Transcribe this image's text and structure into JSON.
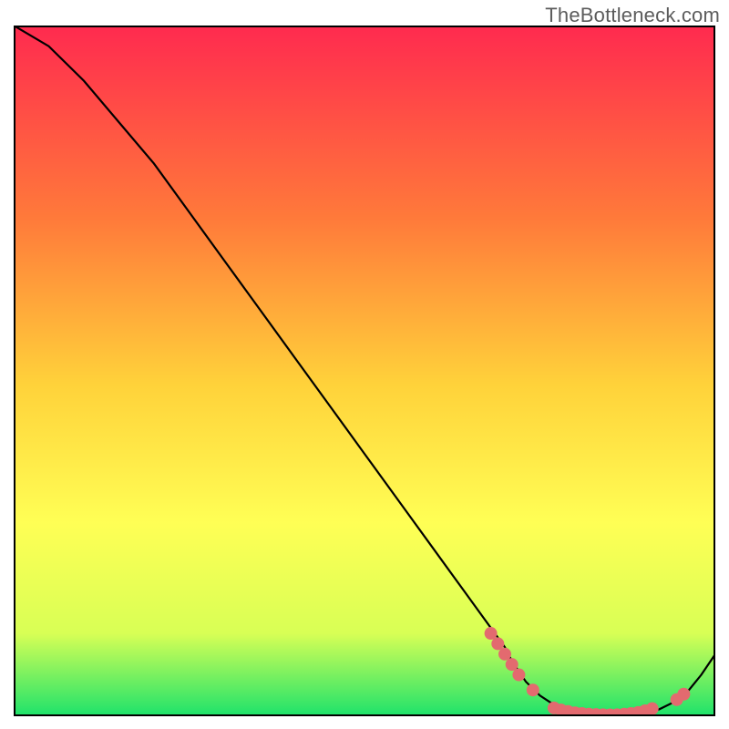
{
  "watermark": "TheBottleneck.com",
  "colors": {
    "gradient_top": "#ff2a4f",
    "gradient_mid1": "#ff7a3a",
    "gradient_mid2": "#ffd23a",
    "gradient_mid3": "#ffff55",
    "gradient_mid4": "#d8ff55",
    "gradient_bottom": "#1de26b",
    "curve": "#000000",
    "marker_fill": "#e36a6f",
    "marker_stroke": "#d0555a",
    "border": "#000000"
  },
  "chart_data": {
    "type": "line",
    "title": "",
    "xlabel": "",
    "ylabel": "",
    "xlim": [
      0,
      100
    ],
    "ylim": [
      0,
      100
    ],
    "series": [
      {
        "name": "bottleneck-curve",
        "x": [
          0,
          5,
          10,
          15,
          20,
          25,
          30,
          35,
          40,
          45,
          50,
          55,
          60,
          65,
          70,
          71,
          73,
          75,
          78,
          80,
          82,
          84,
          86,
          88,
          90,
          92,
          94,
          96,
          98,
          100
        ],
        "y": [
          100,
          97,
          92,
          86,
          80,
          73,
          66,
          59,
          52,
          45,
          38,
          31,
          24,
          17,
          10,
          8,
          5,
          3,
          1,
          0.5,
          0.3,
          0.2,
          0.2,
          0.3,
          0.6,
          1,
          2,
          3.5,
          6,
          9
        ]
      }
    ],
    "markers": {
      "name": "highlight-points",
      "points": [
        {
          "x": 68,
          "y": 12
        },
        {
          "x": 69,
          "y": 10.5
        },
        {
          "x": 70,
          "y": 9
        },
        {
          "x": 71,
          "y": 7.5
        },
        {
          "x": 72,
          "y": 6
        },
        {
          "x": 74,
          "y": 3.8
        },
        {
          "x": 77,
          "y": 1.2
        },
        {
          "x": 78,
          "y": 0.9
        },
        {
          "x": 79,
          "y": 0.7
        },
        {
          "x": 80,
          "y": 0.5
        },
        {
          "x": 81,
          "y": 0.4
        },
        {
          "x": 82,
          "y": 0.3
        },
        {
          "x": 83,
          "y": 0.25
        },
        {
          "x": 84,
          "y": 0.22
        },
        {
          "x": 85,
          "y": 0.2
        },
        {
          "x": 86,
          "y": 0.22
        },
        {
          "x": 87,
          "y": 0.3
        },
        {
          "x": 88,
          "y": 0.4
        },
        {
          "x": 89,
          "y": 0.55
        },
        {
          "x": 90,
          "y": 0.8
        },
        {
          "x": 91,
          "y": 1.1
        },
        {
          "x": 94.5,
          "y": 2.4
        },
        {
          "x": 95.5,
          "y": 3.2
        }
      ]
    }
  }
}
